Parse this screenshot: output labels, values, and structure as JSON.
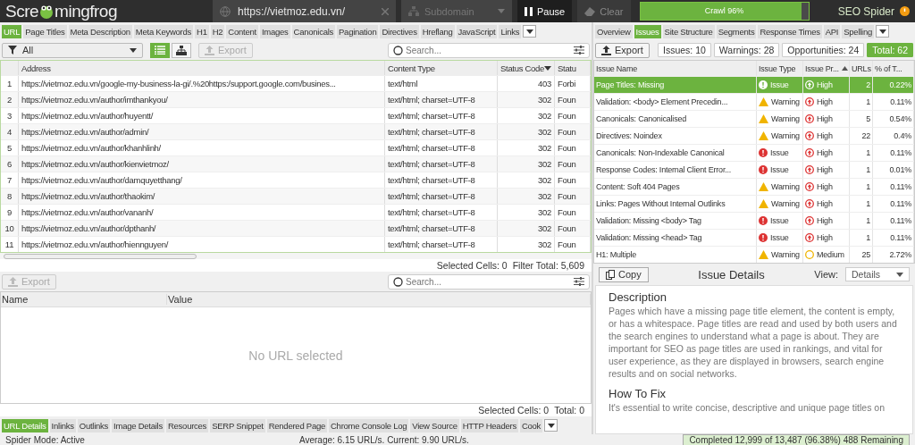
{
  "top_bar": {
    "logo_left": "Scre",
    "logo_right": "mingfrog",
    "brand": "SEO Spider"
  },
  "url_field": {
    "value": "https://vietmoz.edu.vn/"
  },
  "mode_dropdown": {
    "value": "Subdomain",
    "disabled": true
  },
  "pause_button": {
    "label": "Pause"
  },
  "clear_button": {
    "label": "Clear",
    "disabled": true
  },
  "crawl_progress": {
    "label": "Crawl 96%",
    "level": 0.96
  },
  "left_tabs": [
    {
      "label": "URL",
      "selected": true
    },
    {
      "label": "Page Titles",
      "selected": false
    },
    {
      "label": "Meta Description",
      "selected": false
    },
    {
      "label": "Meta Keywords",
      "selected": false
    },
    {
      "label": "H1",
      "selected": false
    },
    {
      "label": "H2",
      "selected": false
    },
    {
      "label": "Content",
      "selected": false
    },
    {
      "label": "Images",
      "selected": false
    },
    {
      "label": "Canonicals",
      "selected": false
    },
    {
      "label": "Pagination",
      "selected": false
    },
    {
      "label": "Directives",
      "selected": false
    },
    {
      "label": "Hreflang",
      "selected": false
    },
    {
      "label": "JavaScript",
      "selected": false
    },
    {
      "label": "Links",
      "selected": false
    }
  ],
  "filter": {
    "value": "All"
  },
  "view_toggle": [
    {
      "kind": "list",
      "selected": true
    },
    {
      "kind": "tree",
      "selected": false
    }
  ],
  "export_button": {
    "label": "Export",
    "disabled": true
  },
  "search": {
    "placeholder": "Search..."
  },
  "table": {
    "columns": [
      "Address",
      "Content Type",
      "Status Code",
      "Statu"
    ],
    "rows": [
      {
        "index": "1",
        "address": "https://vietmoz.edu.vn/google-my-business-la-gi/.%20https:/support.google.com/busines...",
        "content_type": "text/html",
        "status_code": "403",
        "status": "Forbi"
      },
      {
        "index": "2",
        "address": "https://vietmoz.edu.vn/author/imthankyou/",
        "content_type": "text/html; charset=UTF-8",
        "status_code": "302",
        "status": "Foun"
      },
      {
        "index": "3",
        "address": "https://vietmoz.edu.vn/author/huyentt/",
        "content_type": "text/html; charset=UTF-8",
        "status_code": "302",
        "status": "Foun"
      },
      {
        "index": "4",
        "address": "https://vietmoz.edu.vn/author/admin/",
        "content_type": "text/html; charset=UTF-8",
        "status_code": "302",
        "status": "Foun"
      },
      {
        "index": "5",
        "address": "https://vietmoz.edu.vn/author/khanhlinh/",
        "content_type": "text/html; charset=UTF-8",
        "status_code": "302",
        "status": "Foun"
      },
      {
        "index": "6",
        "address": "https://vietmoz.edu.vn/author/kienvietmoz/",
        "content_type": "text/html; charset=UTF-8",
        "status_code": "302",
        "status": "Foun"
      },
      {
        "index": "7",
        "address": "https://vietmoz.edu.vn/author/damquyetthang/",
        "content_type": "text/html; charset=UTF-8",
        "status_code": "302",
        "status": "Foun"
      },
      {
        "index": "8",
        "address": "https://vietmoz.edu.vn/author/thaokim/",
        "content_type": "text/html; charset=UTF-8",
        "status_code": "302",
        "status": "Foun"
      },
      {
        "index": "9",
        "address": "https://vietmoz.edu.vn/author/vananh/",
        "content_type": "text/html; charset=UTF-8",
        "status_code": "302",
        "status": "Foun"
      },
      {
        "index": "10",
        "address": "https://vietmoz.edu.vn/author/dpthanh/",
        "content_type": "text/html; charset=UTF-8",
        "status_code": "302",
        "status": "Foun"
      },
      {
        "index": "11",
        "address": "https://vietmoz.edu.vn/author/hiennguyen/",
        "content_type": "text/html; charset=UTF-8",
        "status_code": "302",
        "status": "Foun"
      }
    ]
  },
  "table_status": {
    "selected_cells": "Selected Cells:  0",
    "filter_total": "Filter Total:  5,609"
  },
  "detail_pane": {
    "export_button": {
      "label": "Export",
      "disabled": true
    },
    "search": {
      "placeholder": "Search..."
    },
    "columns": [
      "Name",
      "Value"
    ],
    "empty_message": "No URL selected",
    "selected_cells": "Selected Cells:  0",
    "total": "Total:  0"
  },
  "detail_tabs": [
    {
      "label": "URL Details",
      "selected": true
    },
    {
      "label": "Inlinks",
      "selected": false
    },
    {
      "label": "Outlinks",
      "selected": false
    },
    {
      "label": "Image Details",
      "selected": false
    },
    {
      "label": "Resources",
      "selected": false
    },
    {
      "label": "SERP Snippet",
      "selected": false
    },
    {
      "label": "Rendered Page",
      "selected": false
    },
    {
      "label": "Chrome Console Log",
      "selected": false
    },
    {
      "label": "View Source",
      "selected": false
    },
    {
      "label": "HTTP Headers",
      "selected": false
    },
    {
      "label": "Cook",
      "selected": false
    }
  ],
  "right_tabs": [
    {
      "label": "Overview",
      "selected": false
    },
    {
      "label": "Issues",
      "selected": true
    },
    {
      "label": "Site Structure",
      "selected": false
    },
    {
      "label": "Segments",
      "selected": false
    },
    {
      "label": "Response Times",
      "selected": false
    },
    {
      "label": "API",
      "selected": false
    },
    {
      "label": "Spelling",
      "selected": false
    }
  ],
  "issues_export": {
    "label": "Export",
    "disabled": false
  },
  "issue_counts": [
    {
      "label": "Issues: 10",
      "selected": false
    },
    {
      "label": "Warnings: 28",
      "selected": false
    },
    {
      "label": "Opportunities: 24",
      "selected": false
    },
    {
      "label": "Total: 62",
      "selected": true
    }
  ],
  "issues_table": {
    "columns": [
      "Issue Name",
      "Issue Type",
      "Issue Pr...",
      "URLs",
      "% of T..."
    ],
    "rows": [
      {
        "name": "Page Titles: Missing",
        "kind": "issue",
        "type": "Issue",
        "priority": {
          "kind": "high",
          "label": "High"
        },
        "urls": "2",
        "percent": "0.22%",
        "selected": true
      },
      {
        "name": "Validation: <body> Element Precedin...",
        "kind": "warning",
        "type": "Warning",
        "priority": {
          "kind": "high",
          "label": "High"
        },
        "urls": "1",
        "percent": "0.11%",
        "selected": false
      },
      {
        "name": "Canonicals: Canonicalised",
        "kind": "warning",
        "type": "Warning",
        "priority": {
          "kind": "high",
          "label": "High"
        },
        "urls": "5",
        "percent": "0.54%",
        "selected": false
      },
      {
        "name": "Directives: Noindex",
        "kind": "warning",
        "type": "Warning",
        "priority": {
          "kind": "high",
          "label": "High"
        },
        "urls": "22",
        "percent": "0.4%",
        "selected": false
      },
      {
        "name": "Canonicals: Non-Indexable Canonical",
        "kind": "issue",
        "type": "Issue",
        "priority": {
          "kind": "high",
          "label": "High"
        },
        "urls": "1",
        "percent": "0.11%",
        "selected": false
      },
      {
        "name": "Response Codes: Internal Client Error...",
        "kind": "issue",
        "type": "Issue",
        "priority": {
          "kind": "high",
          "label": "High"
        },
        "urls": "1",
        "percent": "0.01%",
        "selected": false
      },
      {
        "name": "Content: Soft 404 Pages",
        "kind": "warning",
        "type": "Warning",
        "priority": {
          "kind": "high",
          "label": "High"
        },
        "urls": "1",
        "percent": "0.11%",
        "selected": false
      },
      {
        "name": "Links: Pages Without Internal Outlinks",
        "kind": "warning",
        "type": "Warning",
        "priority": {
          "kind": "high",
          "label": "High"
        },
        "urls": "1",
        "percent": "0.11%",
        "selected": false
      },
      {
        "name": "Validation: Missing <body> Tag",
        "kind": "issue",
        "type": "Issue",
        "priority": {
          "kind": "high",
          "label": "High"
        },
        "urls": "1",
        "percent": "0.11%",
        "selected": false
      },
      {
        "name": "Validation: Missing <head> Tag",
        "kind": "issue",
        "type": "Issue",
        "priority": {
          "kind": "high",
          "label": "High"
        },
        "urls": "1",
        "percent": "0.11%",
        "selected": false
      },
      {
        "name": "H1: Multiple",
        "kind": "warning",
        "type": "Warning",
        "priority": {
          "kind": "medium",
          "label": "Medium"
        },
        "urls": "25",
        "percent": "2.72%",
        "selected": false
      }
    ]
  },
  "issue_details": {
    "copy_button": "Copy",
    "title": "Issue Details",
    "view_label": "View:",
    "view_value": "Details",
    "sections": [
      {
        "heading": "Description",
        "text": "Pages which have a missing page title element, the content is empty, or has a whitespace. Page titles are read and used by both users and the search engines to understand what a page is about. They are important for SEO as page titles are used in rankings, and vital for user experience, as they are displayed in browsers, search engine results and on social networks."
      },
      {
        "heading": "How To Fix",
        "text": "It's essential to write concise, descriptive and unique page titles on"
      }
    ]
  },
  "status_bar": {
    "mode": "Spider Mode: Active",
    "speed": "Average: 6.15 URL/s. Current: 9.90 URL/s.",
    "completed": "Completed 12,999 of 13,487 (96.38%) 488 Remaining"
  }
}
